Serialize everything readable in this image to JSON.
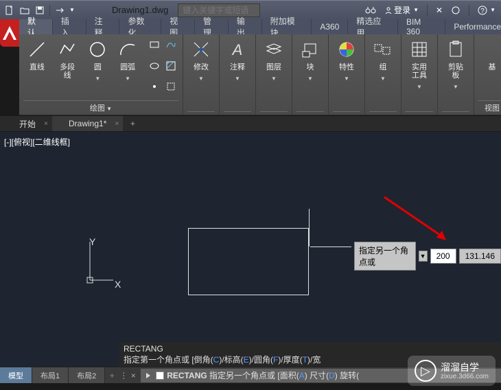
{
  "titlebar": {
    "filename": "Drawing1.dwg",
    "search_placeholder": "键入关键字或短语",
    "login": "登录"
  },
  "tabs": [
    "默认",
    "插入",
    "注释",
    "参数化",
    "视图",
    "管理",
    "输出",
    "附加模块",
    "A360",
    "精选应用",
    "BIM 360",
    "Performance"
  ],
  "active_tab": 0,
  "ribbon": {
    "draw": {
      "label": "绘图",
      "line": "直线",
      "polyline": "多段线",
      "circle": "圆",
      "arc": "圆弧"
    },
    "modify": {
      "label": "修改"
    },
    "annotation": {
      "label": "注释"
    },
    "layer": {
      "label": "图层"
    },
    "block": {
      "label": "块"
    },
    "properties": {
      "label": "特性"
    },
    "group": {
      "label": "组"
    },
    "utilities": {
      "label": "实用工具"
    },
    "clipboard": {
      "label": "剪贴板"
    },
    "base": {
      "label": "基",
      "view": "视图"
    }
  },
  "file_tabs": {
    "start": "开始",
    "drawing": "Drawing1*"
  },
  "view_label": "[-][俯视][二维线框]",
  "ucs": {
    "x": "X",
    "y": "Y"
  },
  "dynamic_input": {
    "label": "指定另一个角点或",
    "val1": "200",
    "val2": "131.146"
  },
  "history": {
    "line1": "RECTANG",
    "line2_prefix": "指定第一个角点或 [倒角(",
    "line2_k1": "C",
    "line2_t1": ")/标高(",
    "line2_k2": "E",
    "line2_t2": ")/圆角(",
    "line2_k3": "F",
    "line2_t3": ")/厚度(",
    "line2_k4": "T",
    "line2_t4": ")/宽"
  },
  "command": {
    "name": "RECTANG",
    "prompt": "指定另一个角点或",
    "opt1_t": "[面积(",
    "opt1_k": "A",
    "opt2_t": ") 尺寸(",
    "opt2_k": "D",
    "opt3_t": ") 旋转("
  },
  "layout_tabs": {
    "model": "模型",
    "layout1": "布局1",
    "layout2": "布局2"
  },
  "watermark": {
    "main": "溜溜自学",
    "sub": "zixue.3d66.com"
  }
}
